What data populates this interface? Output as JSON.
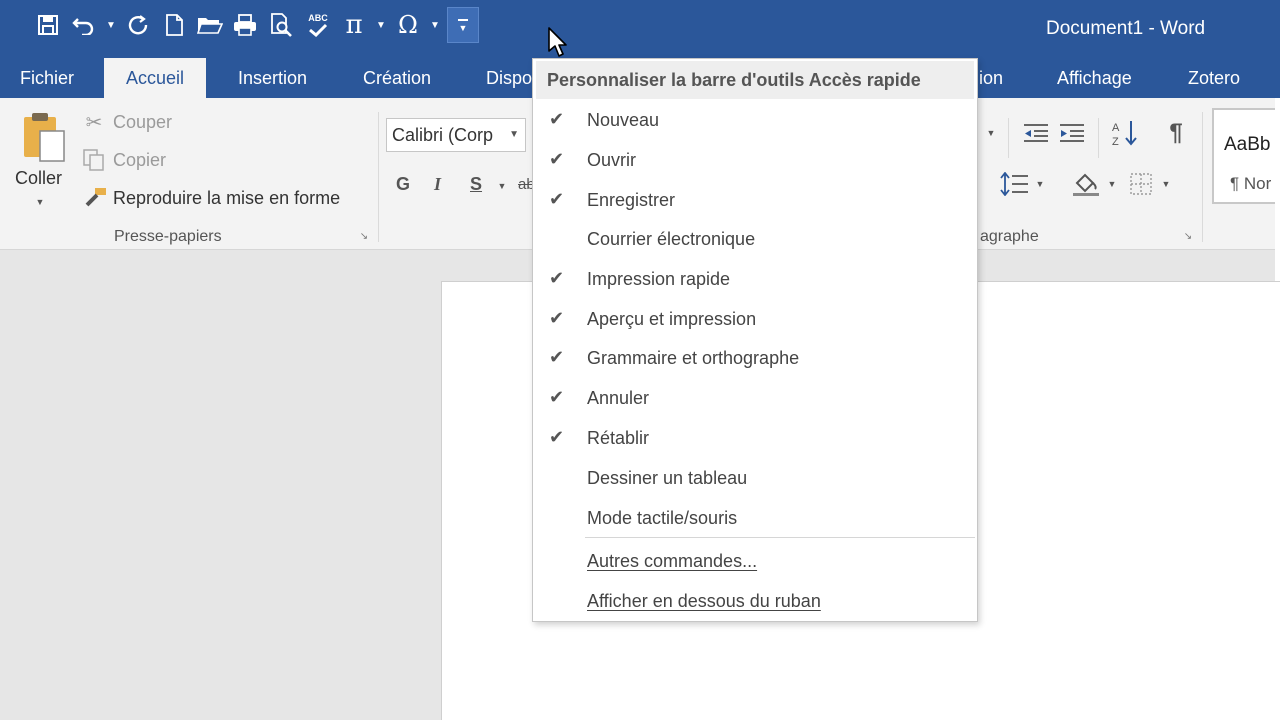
{
  "window": {
    "title": "Document1 - Word"
  },
  "qat": {
    "save_icon": "save-icon",
    "undo_icon": "undo-icon",
    "redo_icon": "redo-icon",
    "new_icon": "new-doc-icon",
    "open_icon": "open-folder-icon",
    "print_icon": "quick-print-icon",
    "preview_icon": "print-preview-icon",
    "spell_icon": "spelling-icon",
    "spell_label": "ABC",
    "equation_glyph": "π",
    "symbol_glyph": "Ω",
    "customize_glyph": "="
  },
  "tabs": [
    {
      "label": "Fichier"
    },
    {
      "label": "Accueil"
    },
    {
      "label": "Insertion"
    },
    {
      "label": "Création"
    },
    {
      "label": "Dispo"
    },
    {
      "label": "ion"
    },
    {
      "label": "Affichage"
    },
    {
      "label": "Zotero"
    }
  ],
  "ribbon": {
    "paste_label": "Coller",
    "cut_label": "Couper",
    "copy_label": "Copier",
    "format_painter_label": "Reproduire la mise en forme",
    "clipboard_group_label": "Presse-papiers",
    "font_name": "Calibri (Corp",
    "bold": "G",
    "italic": "I",
    "underline": "S",
    "strike": "ab",
    "paragraph_group_label": "agraphe",
    "pilcrow": "¶",
    "style_preview": "AaBb",
    "style_name": "¶ Nor"
  },
  "menu": {
    "header": "Personnaliser la barre d'outils Accès rapide",
    "items": [
      {
        "label": "Nouveau",
        "checked": "✔"
      },
      {
        "label": "Ouvrir",
        "checked": "✔"
      },
      {
        "label": "Enregistrer",
        "checked": "✔"
      },
      {
        "label": "Courrier électronique",
        "checked": ""
      },
      {
        "label": "Impression rapide",
        "checked": "✔"
      },
      {
        "label": "Aperçu et impression",
        "checked": "✔"
      },
      {
        "label": "Grammaire et orthographe",
        "checked": "✔"
      },
      {
        "label": "Annuler",
        "checked": "✔"
      },
      {
        "label": "Rétablir",
        "checked": "✔"
      },
      {
        "label": "Dessiner un tableau",
        "checked": ""
      },
      {
        "label": "Mode tactile/souris",
        "checked": ""
      }
    ],
    "more_commands": "Autres commandes...",
    "show_below": "Afficher en dessous du ruban"
  }
}
